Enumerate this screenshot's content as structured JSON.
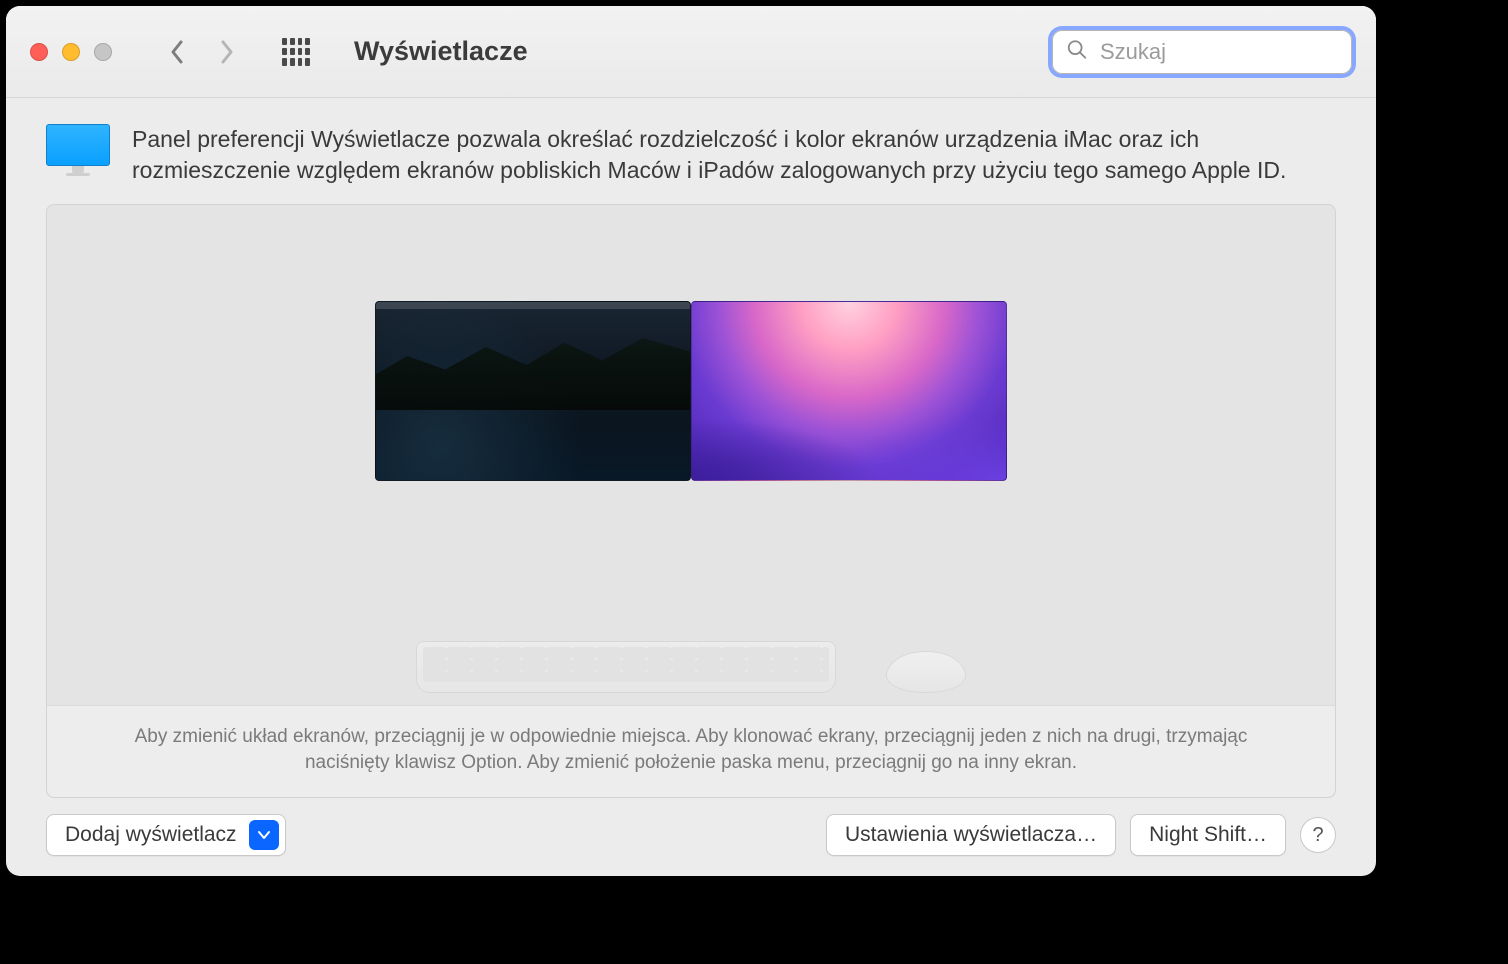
{
  "window": {
    "title": "Wyświetlacze"
  },
  "search": {
    "placeholder": "Szukaj"
  },
  "intro": {
    "text": "Panel preferencji Wyświetlacze pozwala określać rozdzielczość i kolor ekranów urządzenia iMac oraz ich rozmieszczenie względem ekranów pobliskich Maców i iPadów zalogowanych przy użyciu tego samego Apple ID."
  },
  "arrangement": {
    "hint": "Aby zmienić układ ekranów, przeciągnij je w odpowiednie miejsca. Aby klonować ekrany, przeciągnij jeden z nich na drugi, trzymając naciśnięty klawisz Option. Aby zmienić położenie paska menu, przeciągnij go na inny ekran."
  },
  "footer": {
    "add_display": "Dodaj wyświetlacz",
    "display_settings": "Ustawienia wyświetlacza…",
    "night_shift": "Night Shift…",
    "help": "?"
  }
}
